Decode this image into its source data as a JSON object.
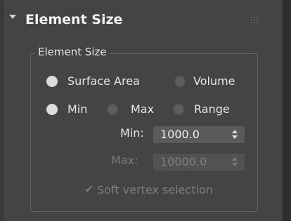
{
  "rollout": {
    "title": "Element Size"
  },
  "group": {
    "legend": "Element Size"
  },
  "radios": {
    "row1": [
      {
        "label": "Surface Area",
        "selected": true
      },
      {
        "label": "Volume",
        "selected": false
      }
    ],
    "row2": [
      {
        "label": "Min",
        "selected": true
      },
      {
        "label": "Max",
        "selected": false
      },
      {
        "label": "Range",
        "selected": false
      }
    ]
  },
  "spinners": {
    "min_label": "Min:",
    "min_value": "1000.0",
    "max_label": "Max:",
    "max_value": "10000.0"
  },
  "checkbox": {
    "label": "Soft vertex selection",
    "checked": true,
    "enabled": false
  },
  "colors": {
    "panel_bg": "#444444",
    "text_primary": "#e6e6e6",
    "text_disabled": "#7c7c7c",
    "radio_selected": "#dcdcdc",
    "spinner_bg": "#5a5a5a"
  }
}
